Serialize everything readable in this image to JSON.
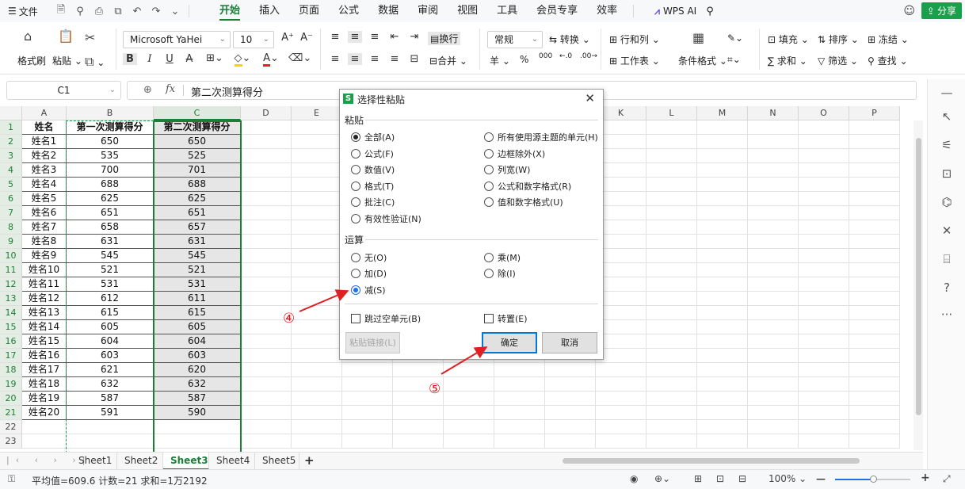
{
  "menubar": {
    "file_label": "文件",
    "tabs": [
      "开始",
      "插入",
      "页面",
      "公式",
      "数据",
      "审阅",
      "视图",
      "工具",
      "会员专享",
      "效率"
    ],
    "active_tab": "开始",
    "wps_ai": "WPS AI",
    "share": "分享"
  },
  "ribbon": {
    "format_painter": "格式刷",
    "paste": "粘贴",
    "font_name": "Microsoft YaHei",
    "font_size": "10",
    "wrap_text": "换行",
    "merge": "合并",
    "number_format": "常规",
    "convert": "转换",
    "rows_cols": "行和列",
    "worksheet": "工作表",
    "conditional_format": "条件格式",
    "fill": "填充",
    "sort": "排序",
    "freeze": "冻结",
    "sum": "求和",
    "filter": "筛选",
    "find": "查找",
    "currency_symbol": "羊",
    "percent_symbol": "%"
  },
  "formula_bar": {
    "cell_ref": "C1",
    "fx": "fx",
    "content": "第二次测算得分"
  },
  "grid": {
    "columns": [
      "A",
      "B",
      "C",
      "D",
      "E",
      "F",
      "G",
      "H",
      "I",
      "J",
      "K",
      "L",
      "M",
      "N",
      "O",
      "P"
    ],
    "row_numbers": [
      "1",
      "2",
      "3",
      "4",
      "5",
      "6",
      "7",
      "8",
      "9",
      "10",
      "11",
      "12",
      "13",
      "14",
      "15",
      "16",
      "17",
      "18",
      "19",
      "20",
      "21",
      "22",
      "23"
    ],
    "headers": [
      "姓名",
      "第一次测算得分",
      "第二次测算得分"
    ],
    "rows": [
      [
        "姓名1",
        "650",
        "650"
      ],
      [
        "姓名2",
        "535",
        "525"
      ],
      [
        "姓名3",
        "700",
        "701"
      ],
      [
        "姓名4",
        "688",
        "688"
      ],
      [
        "姓名5",
        "625",
        "625"
      ],
      [
        "姓名6",
        "651",
        "651"
      ],
      [
        "姓名7",
        "658",
        "657"
      ],
      [
        "姓名8",
        "631",
        "631"
      ],
      [
        "姓名9",
        "545",
        "545"
      ],
      [
        "姓名10",
        "521",
        "521"
      ],
      [
        "姓名11",
        "531",
        "531"
      ],
      [
        "姓名12",
        "612",
        "611"
      ],
      [
        "姓名13",
        "615",
        "615"
      ],
      [
        "姓名14",
        "605",
        "605"
      ],
      [
        "姓名15",
        "604",
        "604"
      ],
      [
        "姓名16",
        "603",
        "603"
      ],
      [
        "姓名17",
        "621",
        "620"
      ],
      [
        "姓名18",
        "632",
        "632"
      ],
      [
        "姓名19",
        "587",
        "587"
      ],
      [
        "姓名20",
        "591",
        "590"
      ]
    ]
  },
  "sheets": {
    "tabs": [
      "Sheet1",
      "Sheet2",
      "Sheet3",
      "Sheet4",
      "Sheet5"
    ],
    "active": "Sheet3",
    "add": "+"
  },
  "statusbar": {
    "summary": "平均值=609.6  计数=21  求和=1万2192",
    "zoom": "100%",
    "zoom_fraction": 0.5
  },
  "dialog": {
    "title": "选择性粘贴",
    "logo": "S",
    "paste_group": "粘贴",
    "paste_options": [
      {
        "label": "全部(A)",
        "checked": true
      },
      {
        "label": "所有使用源主题的单元(H)",
        "checked": false
      },
      {
        "label": "公式(F)",
        "checked": false
      },
      {
        "label": "边框除外(X)",
        "checked": false
      },
      {
        "label": "数值(V)",
        "checked": false
      },
      {
        "label": "列宽(W)",
        "checked": false
      },
      {
        "label": "格式(T)",
        "checked": false
      },
      {
        "label": "公式和数字格式(R)",
        "checked": false
      },
      {
        "label": "批注(C)",
        "checked": false
      },
      {
        "label": "值和数字格式(U)",
        "checked": false
      },
      {
        "label": "有效性验证(N)",
        "checked": false
      }
    ],
    "operation_group": "运算",
    "operation_options": [
      {
        "label": "无(O)",
        "checked": false
      },
      {
        "label": "乘(M)",
        "checked": false
      },
      {
        "label": "加(D)",
        "checked": false
      },
      {
        "label": "除(I)",
        "checked": false
      },
      {
        "label": "减(S)",
        "checked": true
      }
    ],
    "skip_blanks": "跳过空单元(B)",
    "transpose": "转置(E)",
    "paste_link": "粘贴链接(L)",
    "ok": "确定",
    "cancel": "取消"
  },
  "annotations": {
    "step4": "④",
    "step5": "⑤",
    "color": "#e02020"
  }
}
